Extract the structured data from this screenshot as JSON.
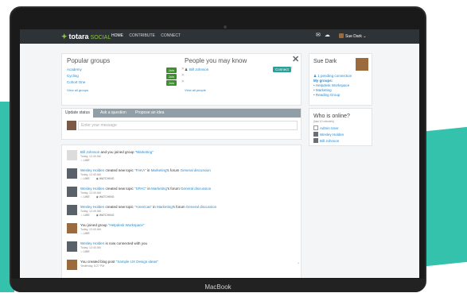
{
  "device": {
    "label": "MacBook"
  },
  "topbar": {
    "brand": "totara",
    "brand_suffix": "SOCIAL",
    "nav": [
      "HOME",
      "CONTRIBUTE",
      "CONNECT"
    ],
    "user_name": "Sue Dark"
  },
  "popular_groups": {
    "title": "Popular groups",
    "groups": [
      {
        "name": "Academy",
        "join": "Join"
      },
      {
        "name": "Cycling",
        "join": "Join"
      },
      {
        "name": "Cohort One",
        "join": "Join"
      }
    ],
    "view_all": "View all groups"
  },
  "people": {
    "title": "People you may know",
    "person": "Bill Johnson",
    "connect": "Connect",
    "view_all": "View all people"
  },
  "status": {
    "tabs": [
      "Update status",
      "Ask a question",
      "Propose an idea"
    ],
    "placeholder": "Enter your message"
  },
  "feed": [
    {
      "actor": "Bill Johnson",
      "text": " and you joined group ",
      "target": "\"Marketing\"",
      "time": "Today, 12:40 AM",
      "actions": [
        "LIKE"
      ]
    },
    {
      "actor": "Wesley Holden",
      "text": " created new topic ",
      "target": "\"FAKA\"",
      "extra": " in ",
      "place": "Marketing",
      "extra2": "'s forum ",
      "forum": "General discussion",
      "time": "Today, 12:40 AM",
      "actions": [
        "LIKE",
        "WATCHING"
      ]
    },
    {
      "actor": "Wesley Holden",
      "text": " created new topic ",
      "target": "\"SPAC\"",
      "extra": " in ",
      "place": "Marketing",
      "extra2": "'s forum ",
      "forum": "General discussion",
      "time": "Today, 12:40 AM",
      "actions": [
        "LIKE",
        "WATCHING"
      ]
    },
    {
      "actor": "Wesley Holden",
      "text": " created new topic ",
      "target": "\"Americas\"",
      "extra": " in ",
      "place": "Marketing",
      "extra2": "'s forum ",
      "forum": "General discussion",
      "time": "Today, 12:40 AM",
      "actions": [
        "LIKE",
        "WATCHING"
      ]
    },
    {
      "actor": "You",
      "text": " joined group ",
      "target": "\"Helpdesk Workspace\"",
      "time": "Today, 12:40 AM",
      "actions": [
        "LIKE"
      ]
    },
    {
      "actor": "Wesley Holden",
      "text": " is now connected with you",
      "target": "",
      "time": "Today, 12:40 AM",
      "actions": [
        "LIKE"
      ]
    },
    {
      "actor": "You",
      "text": " created blog post ",
      "target": "\"Sample UX Design ideas\"",
      "time": "Yesterday, 5:27 PM",
      "actions": []
    }
  ],
  "user_card": {
    "name": "Sue Dark",
    "pending": "1 pending connection",
    "groups_heading": "My groups:",
    "groups": [
      "Helpdesk Workspace",
      "Marketing",
      "Reading Group"
    ]
  },
  "online": {
    "title": "Who is online?",
    "subtitle": "(last 10 minutes)",
    "users": [
      "Admin User",
      "Wesley Holden",
      "Bill Johnson"
    ]
  },
  "colors": {
    "accent_green": "#8dc63f",
    "join_green": "#3e8f2e",
    "connect_teal": "#2aa198",
    "link_blue": "#2d89c8",
    "topbar_dark": "#2e3338"
  }
}
